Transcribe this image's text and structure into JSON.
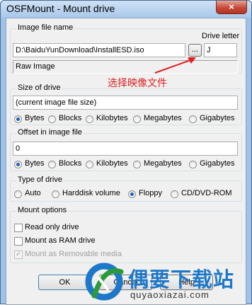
{
  "window": {
    "title": "OSFMount - Mount drive",
    "close_glyph": "×"
  },
  "image_file": {
    "group_label": "Image file name",
    "drive_letter_label": "Drive letter",
    "path": "D:\\BaiduYunDownload\\InstallESD.iso",
    "browse_label": "...",
    "drive_letter": "J",
    "image_type": "Raw Image"
  },
  "size": {
    "group_label": "Size of drive",
    "value": "(current image file size)",
    "units": [
      "Bytes",
      "Blocks",
      "Kilobytes",
      "Megabytes",
      "Gigabytes"
    ],
    "selected": "Bytes"
  },
  "offset": {
    "group_label": "Offset in image file",
    "value": "0",
    "units": [
      "Bytes",
      "Blocks",
      "Kilobytes",
      "Megabytes",
      "Gigabytes"
    ],
    "selected": "Bytes"
  },
  "drive_type": {
    "group_label": "Type of drive",
    "options": [
      "Auto",
      "Harddisk volume",
      "Floppy",
      "CD/DVD-ROM"
    ],
    "selected": "Floppy"
  },
  "mount_options": {
    "group_label": "Mount options",
    "read_only": "Read only drive",
    "ram_drive": "Mount as RAM drive",
    "removable": "Mount as Removable media"
  },
  "buttons": {
    "ok": "OK",
    "cancel": "Cancel",
    "help": "Help"
  },
  "annotation": {
    "text": "选择映像文件",
    "color": "#e02020"
  },
  "watermark": {
    "brand": "偶要下载站",
    "url": "quyaoxiazai.com"
  }
}
